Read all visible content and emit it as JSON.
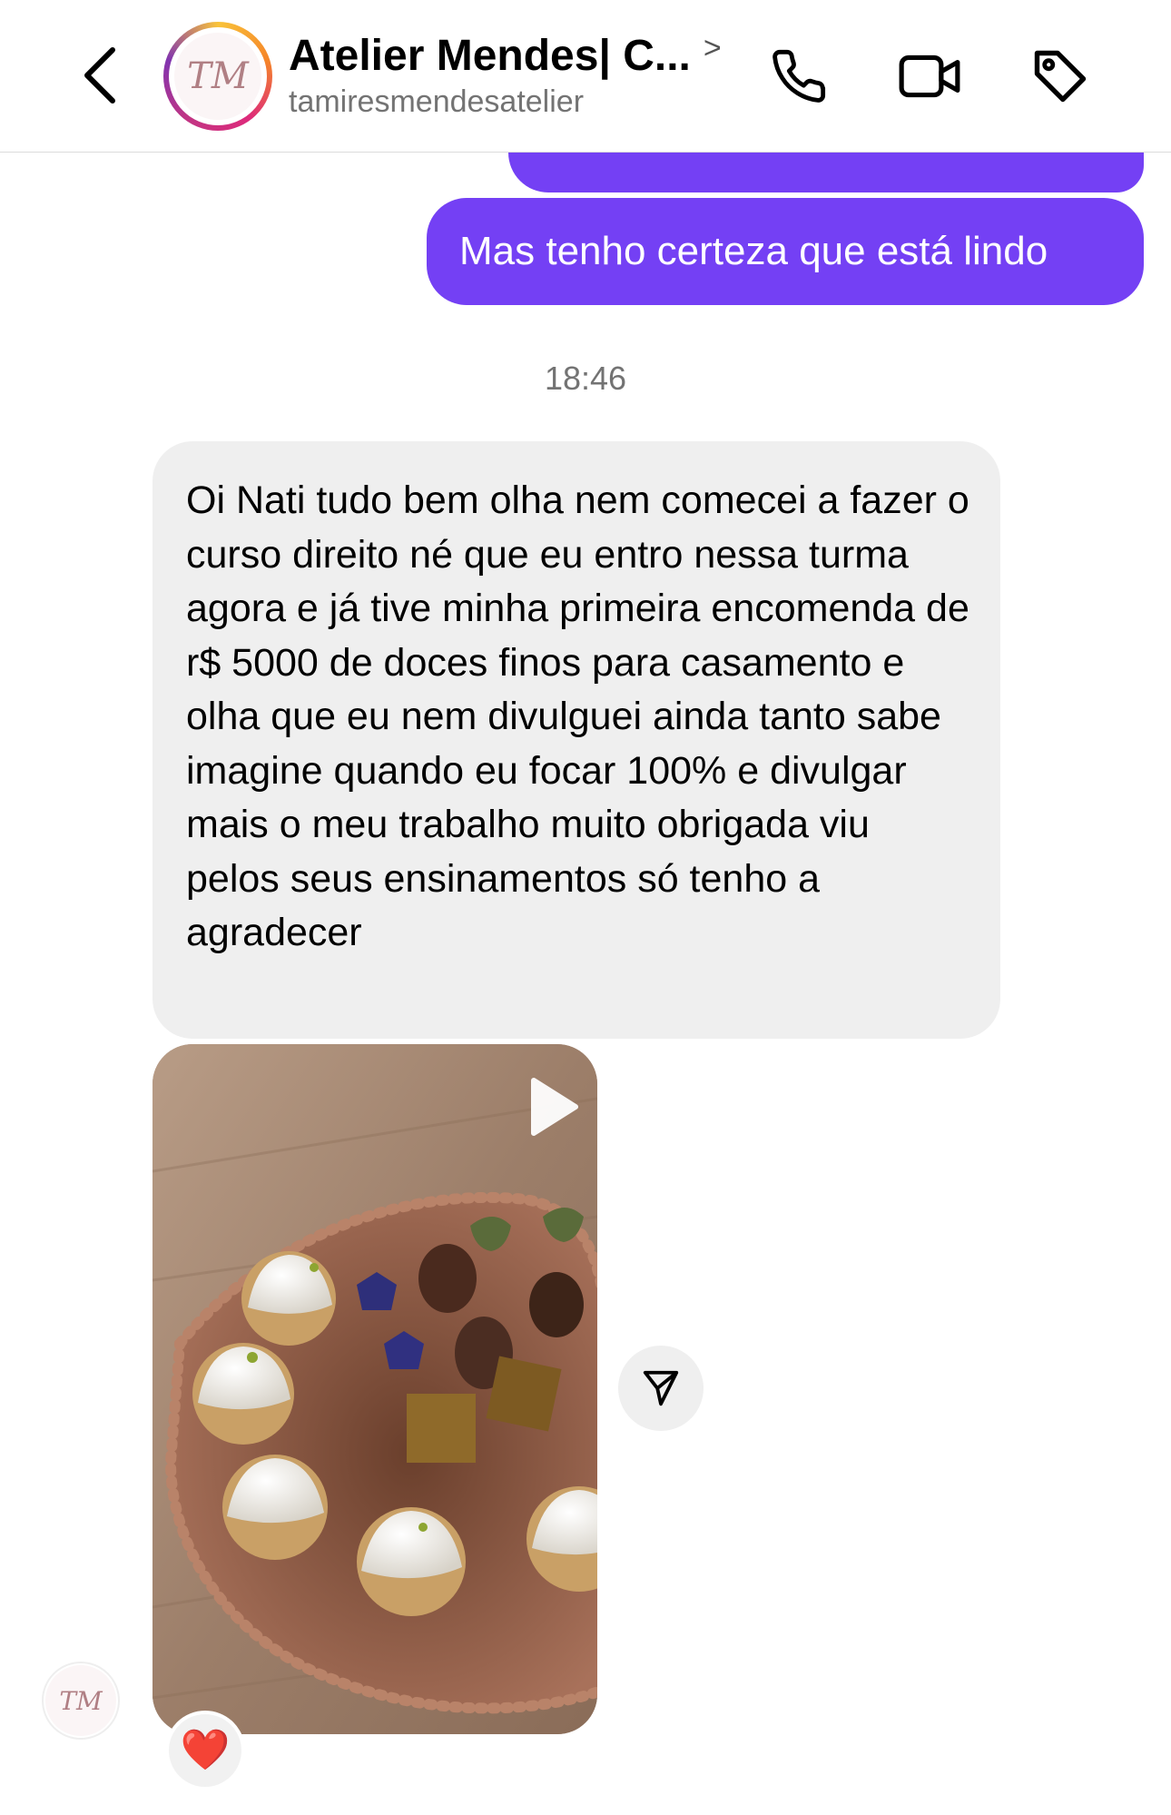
{
  "header": {
    "title": "Atelier Mendes| C...",
    "username": "tamiresmendesatelier",
    "avatar_monogram": "TM"
  },
  "messages": {
    "sent_1": "Mas tenho certeza que está lindo",
    "timestamp": "18:46",
    "received_1": "Oi Nati tudo bem olha nem comecei a fazer o curso direito né que eu entro nessa turma agora e já tive minha primeira encomenda de r$ 5000 de doces finos para casamento e olha que eu nem divulguei ainda tanto sabe imagine quando eu focar 100% e divulgar mais o meu trabalho muito obrigada viu pelos seus ensinamentos só tenho a agradecer"
  },
  "reaction": {
    "emoji": "❤️"
  },
  "colors": {
    "accent": "#7440f4",
    "received_bubble": "#efefef",
    "muted_text": "#737373"
  },
  "icons": [
    "back-arrow-icon",
    "chevron-right-icon",
    "phone-icon",
    "video-camera-icon",
    "tag-icon",
    "play-icon",
    "send-icon",
    "heart-icon"
  ]
}
